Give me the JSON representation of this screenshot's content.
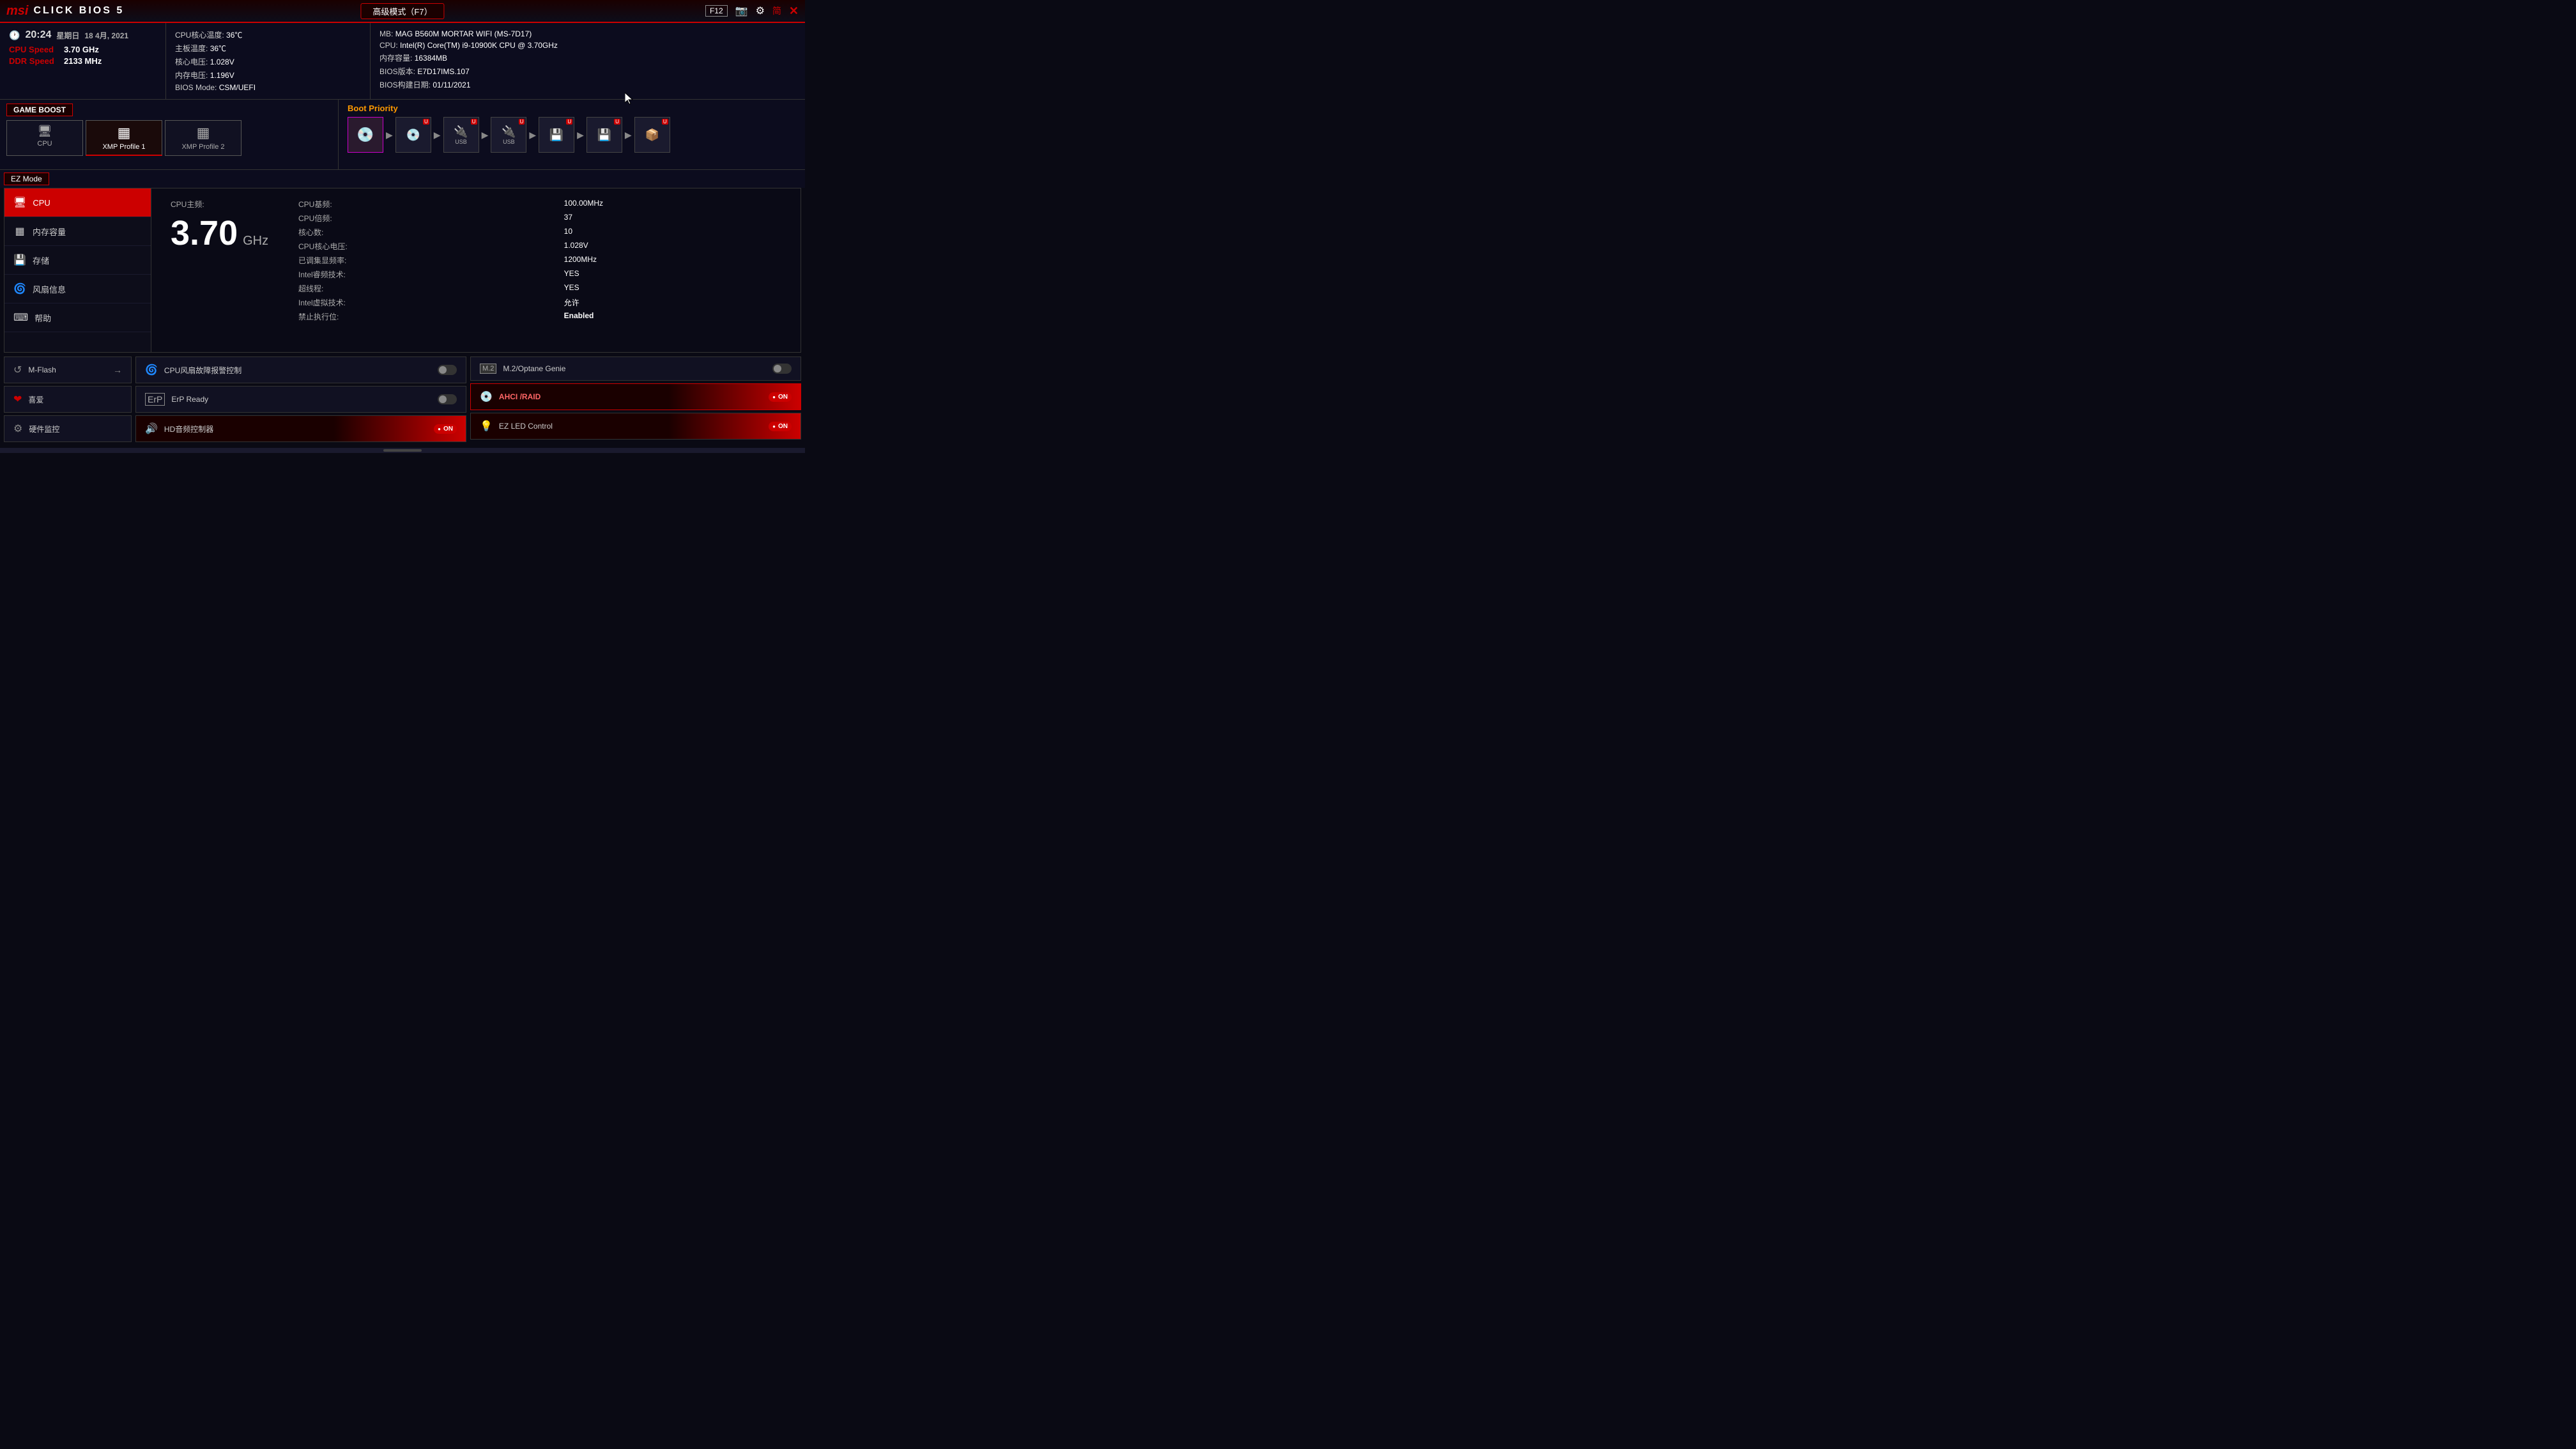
{
  "topbar": {
    "logo": "msi",
    "bios_title": "CLICK BIOS 5",
    "advanced_mode": "高级模式（F7）",
    "f12_label": "F12",
    "simplified_label": "简",
    "close_icon": "✕"
  },
  "info_header": {
    "time": "20:24",
    "weekday": "星期日",
    "date": "18 4月, 2021",
    "cpu_speed_label": "CPU Speed",
    "cpu_speed_value": "3.70 GHz",
    "ddr_speed_label": "DDR Speed",
    "ddr_speed_value": "2133 MHz",
    "cpu_temp_label": "CPU核心温度:",
    "cpu_temp_value": "36℃",
    "mb_temp_label": "主板温度:",
    "mb_temp_value": "36℃",
    "core_voltage_label": "核心电压:",
    "core_voltage_value": "1.028V",
    "mem_voltage_label": "内存电压:",
    "mem_voltage_value": "1.196V",
    "bios_mode_label": "BIOS Mode:",
    "bios_mode_value": "CSM/UEFI",
    "mb_label": "MB:",
    "mb_value": "MAG B560M MORTAR WIFI (MS-7D17)",
    "cpu_label": "CPU:",
    "cpu_value": "Intel(R) Core(TM) i9-10900K CPU @ 3.70GHz",
    "mem_label": "内存容量:",
    "mem_value": "16384MB",
    "bios_ver_label": "BIOS版本:",
    "bios_ver_value": "E7D17IMS.107",
    "bios_date_label": "BIOS构建日期:",
    "bios_date_value": "01/11/2021"
  },
  "game_boost": {
    "label": "GAME BOOST",
    "tabs": [
      {
        "id": "cpu",
        "label": "CPU",
        "icon": "🖥"
      },
      {
        "id": "xmp1",
        "label": "XMP Profile 1",
        "icon": "▦"
      },
      {
        "id": "xmp2",
        "label": "XMP Profile 2",
        "icon": "▦"
      }
    ]
  },
  "boot_priority": {
    "title": "Boot Priority",
    "devices": [
      {
        "icon": "💿",
        "label": "",
        "usb": false
      },
      {
        "icon": "💿",
        "label": "",
        "usb": true
      },
      {
        "icon": "🔌",
        "label": "USB",
        "usb": true
      },
      {
        "icon": "🔌",
        "label": "USB",
        "usb": true
      },
      {
        "icon": "💾",
        "label": "",
        "usb": true
      },
      {
        "icon": "💾",
        "label": "",
        "usb": true
      },
      {
        "icon": "📦",
        "label": "",
        "usb": true
      }
    ]
  },
  "ez_mode": {
    "header": "EZ Mode",
    "sidebar": [
      {
        "id": "cpu",
        "label": "CPU",
        "icon": "🖥",
        "active": true
      },
      {
        "id": "memory",
        "label": "内存容量",
        "icon": "▦"
      },
      {
        "id": "storage",
        "label": "存储",
        "icon": "💾"
      },
      {
        "id": "fan",
        "label": "风扇信息",
        "icon": "🌀"
      },
      {
        "id": "help",
        "label": "帮助",
        "icon": "⌨"
      }
    ]
  },
  "cpu_detail": {
    "freq_label": "CPU主频:",
    "freq_value": "3.70",
    "freq_unit": "GHz",
    "specs": [
      {
        "label": "CPU基频:",
        "value": "100.00MHz"
      },
      {
        "label": "CPU倍频:",
        "value": "37"
      },
      {
        "label": "核心数:",
        "value": "10"
      },
      {
        "label": "CPU核心电压:",
        "value": "1.028V"
      },
      {
        "label": "已调集显频率:",
        "value": "1200MHz"
      },
      {
        "label": "Intel睿频技术:",
        "value": "YES"
      },
      {
        "label": "超线程:",
        "value": "YES"
      },
      {
        "label": "Intel虚拟技术:",
        "value": "允许"
      },
      {
        "label": "禁止执行位:",
        "value": "Enabled"
      }
    ]
  },
  "bottom_left": [
    {
      "id": "mflash",
      "label": "M-Flash",
      "icon": "↺"
    },
    {
      "id": "hobby",
      "label": "喜爱",
      "icon": "❤"
    },
    {
      "id": "hwmonitor",
      "label": "硬件监控",
      "icon": "⚙"
    }
  ],
  "bottom_mid": [
    {
      "id": "cpu_fan",
      "label": "CPU风扇故障报警控制",
      "icon": "🌀",
      "toggle": "off"
    },
    {
      "id": "erp",
      "label": "ErP Ready",
      "icon": "ErP",
      "toggle": "off"
    },
    {
      "id": "hd_audio",
      "label": "HD音频控制器",
      "icon": "🔊",
      "toggle": "on"
    }
  ],
  "bottom_right": [
    {
      "id": "m2",
      "label": "M.2/Optane Genie",
      "icon": "M.2",
      "toggle": "off"
    },
    {
      "id": "ahci",
      "label": "AHCI /RAID",
      "icon": "💿",
      "toggle": "on"
    },
    {
      "id": "ez_led",
      "label": "EZ LED Control",
      "icon": "💡",
      "toggle": "on"
    }
  ]
}
